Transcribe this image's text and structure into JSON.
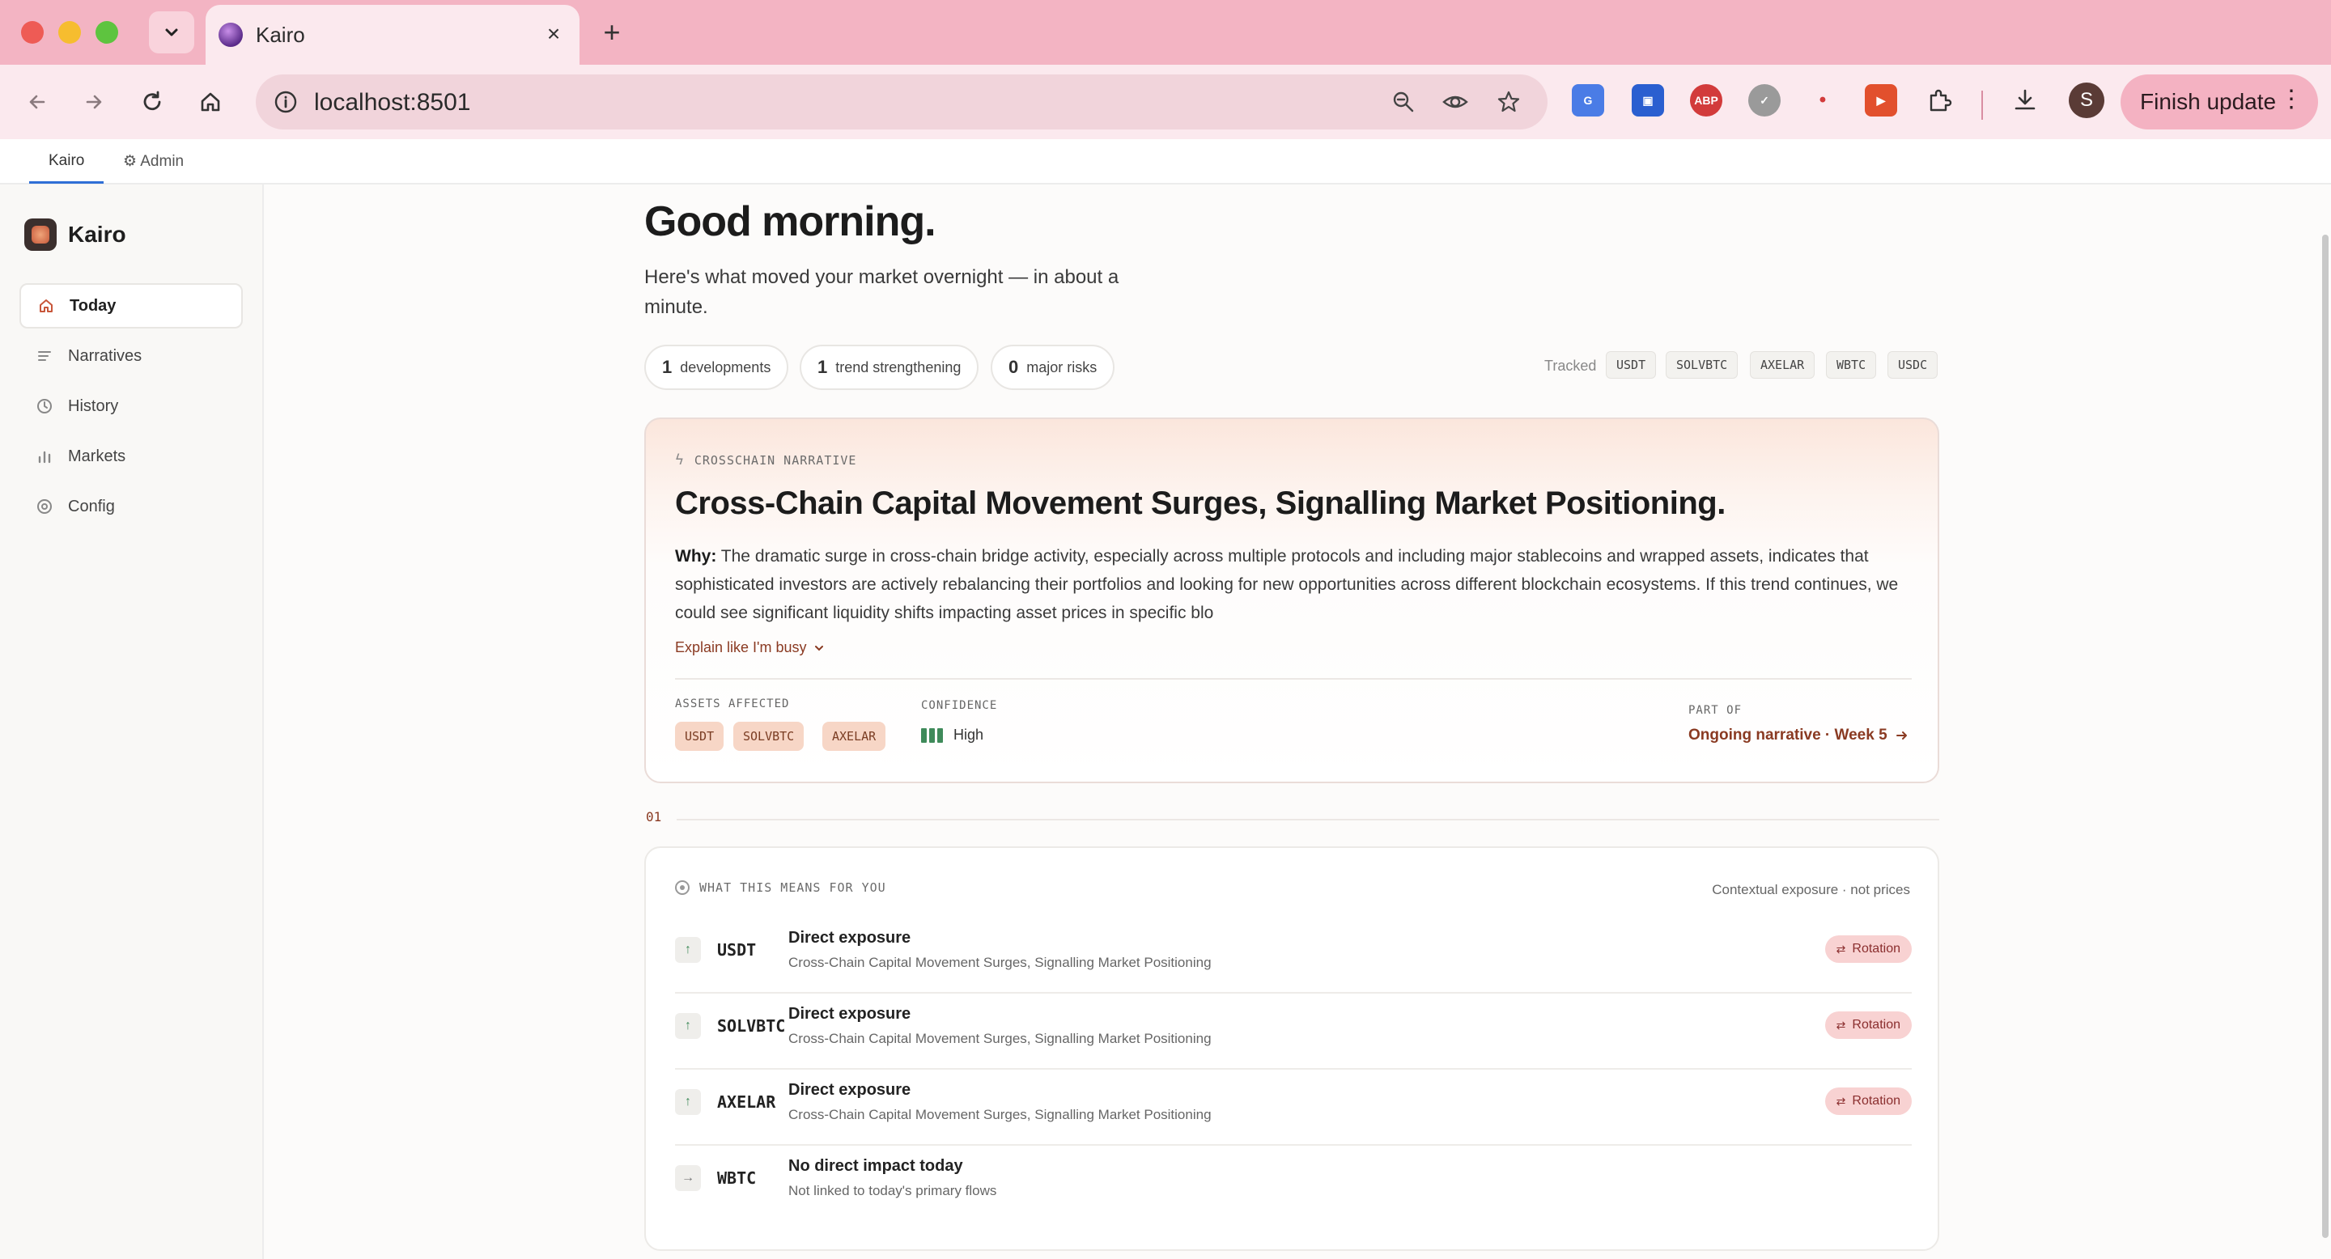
{
  "browser": {
    "tab_title": "Kairo",
    "url": "localhost:8501",
    "profile_initial": "S",
    "finish_update_label": "Finish update"
  },
  "topnav": {
    "items": [
      "Kairo",
      "⚙ Admin"
    ]
  },
  "sidebar": {
    "brand": "Kairo",
    "items": [
      {
        "label": "Today",
        "icon": "home-icon",
        "active": true
      },
      {
        "label": "Narratives",
        "icon": "list-icon"
      },
      {
        "label": "History",
        "icon": "clock-icon"
      },
      {
        "label": "Markets",
        "icon": "bar-chart-icon"
      },
      {
        "label": "Config",
        "icon": "target-icon"
      }
    ]
  },
  "header": {
    "greeting": "Good morning.",
    "subtitle": "Here's what moved your market overnight — in about a minute."
  },
  "stats": [
    {
      "num": "1",
      "label": "developments"
    },
    {
      "num": "1",
      "label": "trend strengthening"
    },
    {
      "num": "0",
      "label": "major risks"
    }
  ],
  "tracked": {
    "label": "Tracked",
    "assets": [
      "USDT",
      "SOLVBTC",
      "AXELAR",
      "WBTC",
      "USDC"
    ]
  },
  "narrative": {
    "kicker": "CROSSCHAIN NARRATIVE",
    "title": "Cross-Chain Capital Movement Surges, Signalling Market Positioning.",
    "why_label": "Why:",
    "why_text": "The dramatic surge in cross-chain bridge activity, especially across multiple protocols and including major stablecoins and wrapped assets, indicates that sophisticated investors are actively rebalancing their portfolios and looking for new opportunities across different blockchain ecosystems. If this trend continues, we could see significant liquidity shifts impacting asset prices in specific blo",
    "explain_label": "Explain like I'm busy",
    "assets_label": "ASSETS AFFECTED",
    "assets": [
      "USDT",
      "SOLVBTC",
      "AXELAR"
    ],
    "confidence_label": "CONFIDENCE",
    "confidence": "High",
    "part_of_label": "PART OF",
    "part_of": "Ongoing narrative · Week 5"
  },
  "section": {
    "number": "01"
  },
  "means": {
    "kicker": "WHAT THIS MEANS FOR YOU",
    "note": "Contextual exposure · not prices",
    "rows": [
      {
        "asset": "USDT",
        "direction": "up",
        "title": "Direct exposure",
        "sub": "Cross-Chain Capital Movement Surges, Signalling Market Positioning",
        "badge": "Rotation"
      },
      {
        "asset": "SOLVBTC",
        "direction": "up",
        "title": "Direct exposure",
        "sub": "Cross-Chain Capital Movement Surges, Signalling Market Positioning",
        "badge": "Rotation"
      },
      {
        "asset": "AXELAR",
        "direction": "up",
        "title": "Direct exposure",
        "sub": "Cross-Chain Capital Movement Surges, Signalling Market Positioning",
        "badge": "Rotation"
      },
      {
        "asset": "WBTC",
        "direction": "neutral",
        "title": "No direct impact today",
        "sub": "Not linked to today's primary flows",
        "badge": ""
      }
    ]
  },
  "colors": {
    "accent": "#c8563a",
    "link": "#8a3a22",
    "tabbar": "#f3b4c3",
    "confidence_high": "#3f8a5a"
  }
}
